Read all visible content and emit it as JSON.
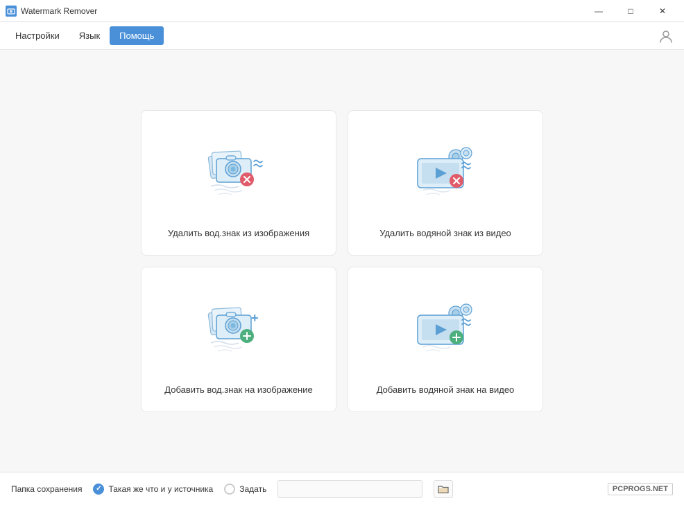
{
  "app": {
    "title": "Watermark Remover",
    "icon": "watermark-icon"
  },
  "titlebar": {
    "minimize_label": "—",
    "maximize_label": "□",
    "close_label": "✕"
  },
  "menu": {
    "items": [
      {
        "id": "settings",
        "label": "Настройки",
        "active": false
      },
      {
        "id": "language",
        "label": "Язык",
        "active": false
      },
      {
        "id": "help",
        "label": "Помощь",
        "active": true
      }
    ]
  },
  "cards": [
    {
      "id": "remove-image-watermark",
      "label": "Удалить вод.знак из изображения",
      "icon_type": "remove-image"
    },
    {
      "id": "remove-video-watermark",
      "label": "Удалить водяной знак из видео",
      "icon_type": "remove-video"
    },
    {
      "id": "add-image-watermark",
      "label": "Добавить вод.знак на изображение",
      "icon_type": "add-image"
    },
    {
      "id": "add-video-watermark",
      "label": "Добавить водяной знак на видео",
      "icon_type": "add-video"
    }
  ],
  "footer": {
    "save_folder_label": "Папка сохранения",
    "radio_same": "Такая же что и у источника",
    "radio_custom": "Задать",
    "folder_input_placeholder": "",
    "folder_button_label": "📁"
  }
}
